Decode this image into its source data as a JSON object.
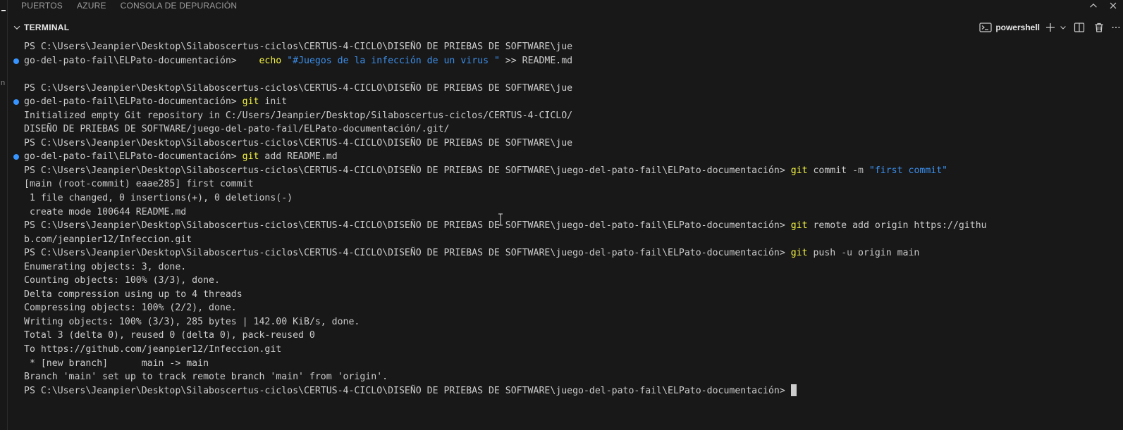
{
  "panel_tabs": [
    "PUERTOS",
    "AZURE",
    "CONSOLA DE DEPURACIÓN"
  ],
  "terminal_header": {
    "title": "TERMINAL",
    "shell": "powershell"
  },
  "icons": {
    "collapse": "chevron-up-icon",
    "section_toggle": "chevron-down-icon",
    "shell": "terminal-icon",
    "new_terminal": "plus-icon",
    "launch_profile": "chevron-down-icon",
    "split": "split-icon",
    "kill": "trash-icon",
    "more": "ellipsis-icon"
  },
  "colors": {
    "background": "#181818",
    "text": "#cccccc",
    "command": "#f5f543",
    "string": "#3b8eea",
    "decoration_dot": "#3794ff"
  },
  "terminal_lines": [
    {
      "dot": false,
      "segments": [
        {
          "t": "PS C:\\Users\\Jeanpier\\Desktop\\Silaboscertus-ciclos\\CERTUS-4-CICLO\\DISEÑO DE PRIEBAS DE SOFTWARE\\jue",
          "c": "plain"
        }
      ]
    },
    {
      "dot": true,
      "segments": [
        {
          "t": "go-del-pato-fail\\ELPato-documentación>    ",
          "c": "plain"
        },
        {
          "t": "echo",
          "c": "cmd"
        },
        {
          "t": " ",
          "c": "plain"
        },
        {
          "t": "\"#Juegos de la infección de un virus \"",
          "c": "str"
        },
        {
          "t": " >> README.md",
          "c": "plain"
        }
      ]
    },
    {
      "dot": false,
      "segments": []
    },
    {
      "dot": false,
      "segments": [
        {
          "t": "PS C:\\Users\\Jeanpier\\Desktop\\Silaboscertus-ciclos\\CERTUS-4-CICLO\\DISEÑO DE PRIEBAS DE SOFTWARE\\jue",
          "c": "plain"
        }
      ]
    },
    {
      "dot": true,
      "segments": [
        {
          "t": "go-del-pato-fail\\ELPato-documentación> ",
          "c": "plain"
        },
        {
          "t": "git",
          "c": "cmd"
        },
        {
          "t": " init",
          "c": "plain"
        }
      ]
    },
    {
      "dot": false,
      "segments": [
        {
          "t": "Initialized empty Git repository in C:/Users/Jeanpier/Desktop/Silaboscertus-ciclos/CERTUS-4-CICLO/",
          "c": "plain"
        }
      ]
    },
    {
      "dot": false,
      "segments": [
        {
          "t": "DISEÑO DE PRIEBAS DE SOFTWARE/juego-del-pato-fail/ELPato-documentación/.git/",
          "c": "plain"
        }
      ]
    },
    {
      "dot": false,
      "segments": [
        {
          "t": "PS C:\\Users\\Jeanpier\\Desktop\\Silaboscertus-ciclos\\CERTUS-4-CICLO\\DISEÑO DE PRIEBAS DE SOFTWARE\\jue",
          "c": "plain"
        }
      ]
    },
    {
      "dot": true,
      "segments": [
        {
          "t": "go-del-pato-fail\\ELPato-documentación> ",
          "c": "plain"
        },
        {
          "t": "git",
          "c": "cmd"
        },
        {
          "t": " add README.md",
          "c": "plain"
        }
      ]
    },
    {
      "dot": false,
      "segments": [
        {
          "t": "PS C:\\Users\\Jeanpier\\Desktop\\Silaboscertus-ciclos\\CERTUS-4-CICLO\\DISEÑO DE PRIEBAS DE SOFTWARE\\juego-del-pato-fail\\ELPato-documentación> ",
          "c": "plain"
        },
        {
          "t": "git",
          "c": "cmd"
        },
        {
          "t": " commit ",
          "c": "plain"
        },
        {
          "t": "-m",
          "c": "flag"
        },
        {
          "t": " ",
          "c": "plain"
        },
        {
          "t": "\"first commit\"",
          "c": "str"
        }
      ]
    },
    {
      "dot": false,
      "segments": [
        {
          "t": "[main (root-commit) eaae285] first commit",
          "c": "plain"
        }
      ]
    },
    {
      "dot": false,
      "segments": [
        {
          "t": " 1 file changed, 0 insertions(+), 0 deletions(-)",
          "c": "plain"
        }
      ]
    },
    {
      "dot": false,
      "segments": [
        {
          "t": " create mode 100644 README.md",
          "c": "plain"
        }
      ]
    },
    {
      "dot": false,
      "segments": [
        {
          "t": "PS C:\\Users\\Jeanpier\\Desktop\\Silaboscertus-ciclos\\CERTUS-4-CICLO\\DISEÑO DE PRIEBAS DE SOFTWARE\\juego-del-pato-fail\\ELPato-documentación> ",
          "c": "plain"
        },
        {
          "t": "git",
          "c": "cmd"
        },
        {
          "t": " remote add origin https://githu",
          "c": "plain"
        }
      ]
    },
    {
      "dot": false,
      "segments": [
        {
          "t": "b.com/jeanpier12/Infeccion.git",
          "c": "plain"
        }
      ]
    },
    {
      "dot": false,
      "segments": [
        {
          "t": "PS C:\\Users\\Jeanpier\\Desktop\\Silaboscertus-ciclos\\CERTUS-4-CICLO\\DISEÑO DE PRIEBAS DE SOFTWARE\\juego-del-pato-fail\\ELPato-documentación> ",
          "c": "plain"
        },
        {
          "t": "git",
          "c": "cmd"
        },
        {
          "t": " push ",
          "c": "plain"
        },
        {
          "t": "-u",
          "c": "flag"
        },
        {
          "t": " origin main",
          "c": "plain"
        }
      ]
    },
    {
      "dot": false,
      "segments": [
        {
          "t": "Enumerating objects: 3, done.",
          "c": "plain"
        }
      ]
    },
    {
      "dot": false,
      "segments": [
        {
          "t": "Counting objects: 100% (3/3), done.",
          "c": "plain"
        }
      ]
    },
    {
      "dot": false,
      "segments": [
        {
          "t": "Delta compression using up to 4 threads",
          "c": "plain"
        }
      ]
    },
    {
      "dot": false,
      "segments": [
        {
          "t": "Compressing objects: 100% (2/2), done.",
          "c": "plain"
        }
      ]
    },
    {
      "dot": false,
      "segments": [
        {
          "t": "Writing objects: 100% (3/3), 285 bytes | 142.00 KiB/s, done.",
          "c": "plain"
        }
      ]
    },
    {
      "dot": false,
      "segments": [
        {
          "t": "Total 3 (delta 0), reused 0 (delta 0), pack-reused 0",
          "c": "plain"
        }
      ]
    },
    {
      "dot": false,
      "segments": [
        {
          "t": "To https://github.com/jeanpier12/Infeccion.git",
          "c": "plain"
        }
      ]
    },
    {
      "dot": false,
      "segments": [
        {
          "t": " * [new branch]      main -> main",
          "c": "plain"
        }
      ]
    },
    {
      "dot": false,
      "segments": [
        {
          "t": "Branch 'main' set up to track remote branch 'main' from 'origin'.",
          "c": "plain"
        }
      ]
    },
    {
      "dot": false,
      "cursor": true,
      "segments": [
        {
          "t": "PS C:\\Users\\Jeanpier\\Desktop\\Silaboscertus-ciclos\\CERTUS-4-CICLO\\DISEÑO DE PRIEBAS DE SOFTWARE\\juego-del-pato-fail\\ELPato-documentación> ",
          "c": "plain"
        }
      ]
    }
  ]
}
